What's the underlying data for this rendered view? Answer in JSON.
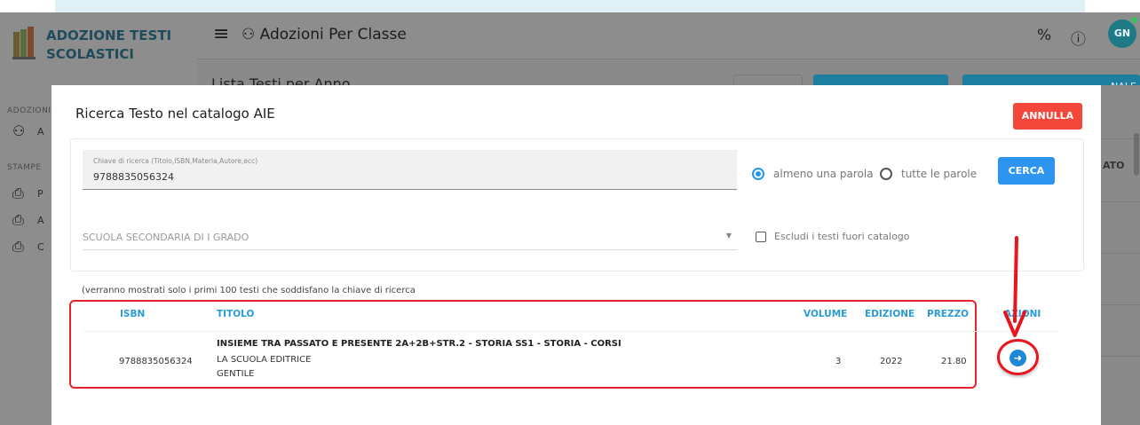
{
  "app": {
    "brand": "ADOZIONE TESTI SCOLASTICI",
    "sidebar_section_1": "ADOZIONI",
    "sidebar_section_2": "STAMPE",
    "sidebar_item_1_short": "A",
    "sidebar_print_1": "P",
    "sidebar_print_2": "A",
    "sidebar_print_3": "C"
  },
  "header": {
    "title": "Adozioni Per Classe",
    "avatar": "GN",
    "icons": [
      "menu-icon",
      "users-icon",
      "percent-icon",
      "info-icon"
    ]
  },
  "background": {
    "title": "Lista Testi per Anno",
    "right_button": "NALE",
    "column_fragment": "ATO"
  },
  "modal": {
    "title": "Ricerca Testo nel catalogo AIE",
    "cancel": "ANNULLA",
    "search": {
      "label": "Chiave di ricerca (Titolo,ISBN,Materia,Autore,ecc)",
      "value": "9788835056324"
    },
    "radio_any": "almeno una parola",
    "radio_all": "tutte le parole",
    "search_button": "CERCA",
    "school_select": "SCUOLA SECONDARIA DI I GRADO",
    "exclude_label": "Escludi i testi fuori catalogo",
    "note": "(verranno mostrati solo i primi 100 testi che soddisfano la chiave di ricerca",
    "columns": [
      "ISBN",
      "TITOLO",
      "VOLUME",
      "EDIZIONE",
      "PREZZO",
      "AZIONI"
    ],
    "rows": [
      {
        "isbn": "9788835056324",
        "title": "INSIEME TRA PASSATO E PRESENTE 2A+2B+STR.2 - STORIA SS1 - STORIA - CORSI",
        "publisher": "LA SCUOLA EDITRICE",
        "author": "GENTILE",
        "volume": "3",
        "edition": "2022",
        "price": "21.80"
      }
    ]
  },
  "colors": {
    "accent": "#2196f3",
    "danger": "#f4473b",
    "header_text": "#2a9bd4",
    "highlight": "#e8222a"
  }
}
